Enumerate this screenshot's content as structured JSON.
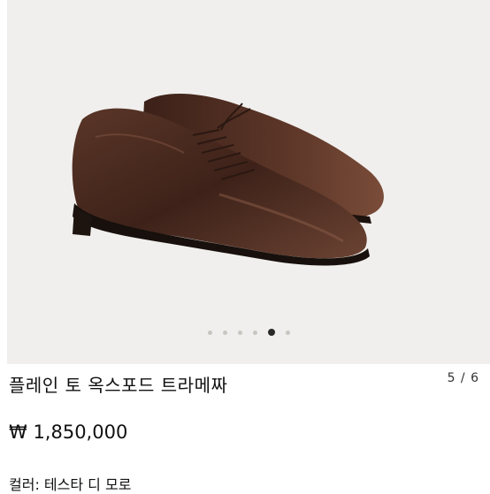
{
  "product": {
    "title": "플레인 토 옥스포드 트라메짜",
    "price": "₩ 1,850,000",
    "color": "컬러: 테스타 디 모로"
  },
  "gallery": {
    "counter": "5 / 6",
    "dot_count": 6,
    "active_index": 4,
    "image": "brown-oxford-shoes-image"
  },
  "colors": {
    "gallery_bg": "#f1efed",
    "leather": "#4a2a20",
    "dot_active": "#2a2a2a",
    "dot_inactive": "#c9c5c1"
  }
}
